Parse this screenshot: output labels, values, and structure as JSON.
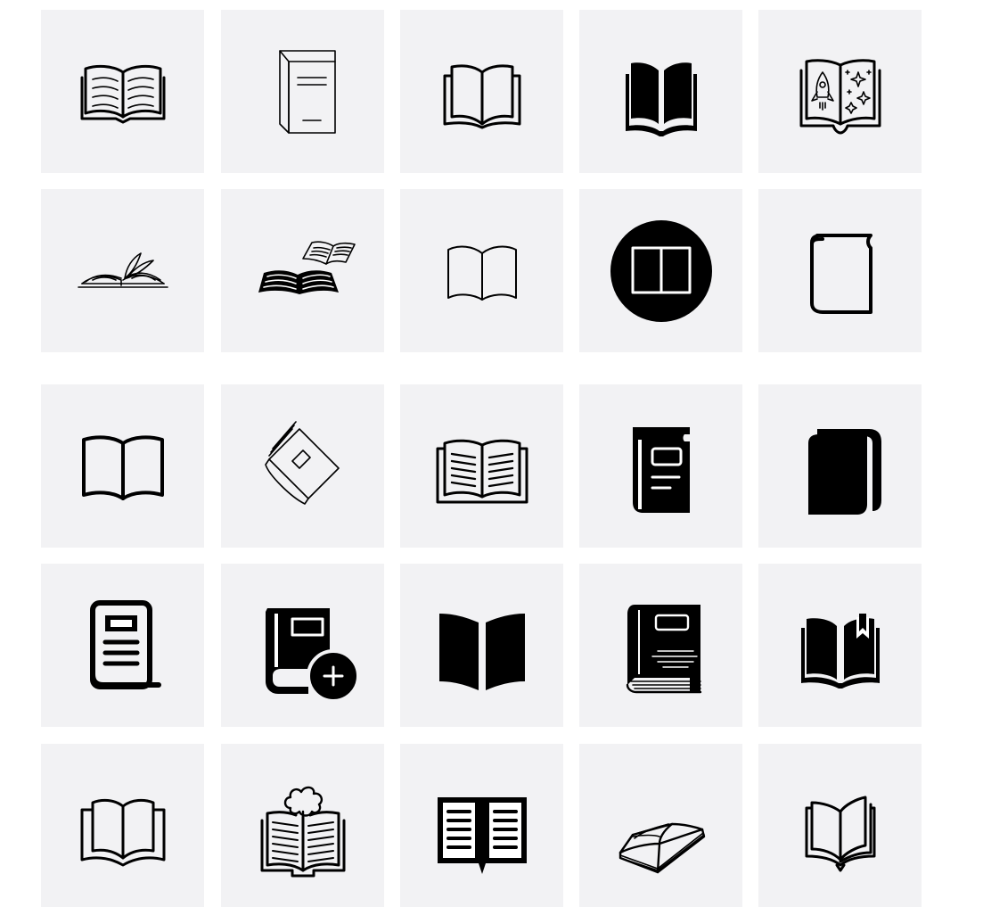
{
  "gallery": {
    "icons": [
      "open-book-lines-icon",
      "closed-book-3d-icon",
      "open-book-outline-icon",
      "open-book-solid-icon",
      "space-story-book-icon",
      "open-book-flipping-pages-icon",
      "stack-of-open-books-icon",
      "open-book-thin-icon",
      "book-circle-icon",
      "closed-book-outline-icon",
      "open-book-simple-icon",
      "notebook-tilted-icon",
      "open-book-text-icon",
      "book-with-label-icon",
      "closed-book-solid-icon",
      "book-cover-lines-icon",
      "add-book-icon",
      "open-book-filled-pages-icon",
      "book-with-pages-icon",
      "open-book-bookmark-icon",
      "open-book-curved-icon",
      "open-book-idea-cloud-icon",
      "open-book-text-solid-icon",
      "open-book-perspective-icon",
      "open-book-layers-icon"
    ],
    "colors": {
      "tile_background": "#f2f2f4",
      "icon": "#000000",
      "page": "#ffffff"
    }
  }
}
